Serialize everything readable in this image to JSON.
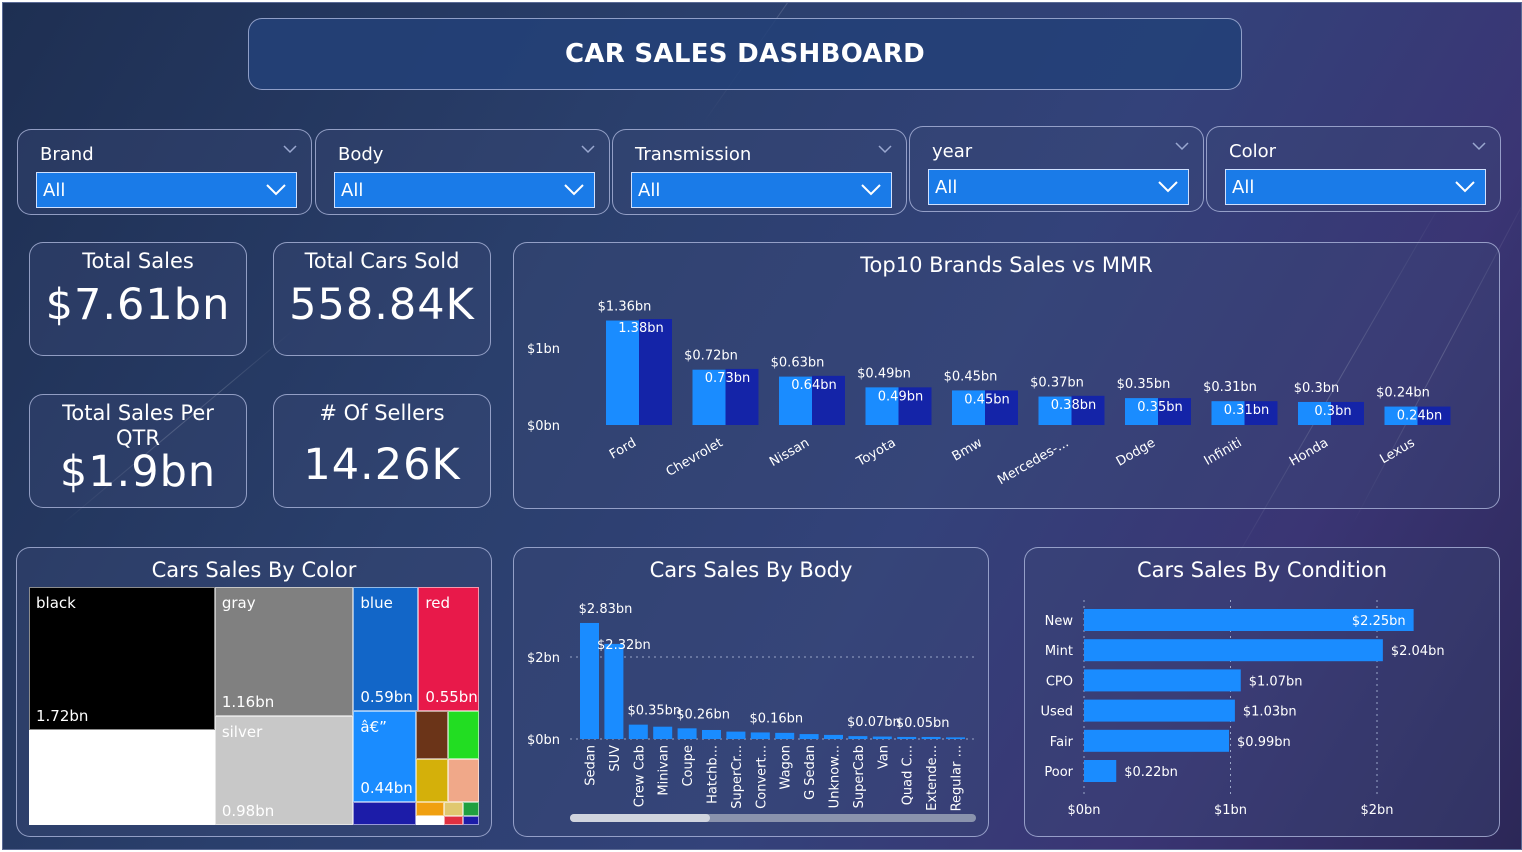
{
  "header": {
    "title": "CAR SALES DASHBOARD"
  },
  "filters": [
    {
      "label": "Brand",
      "value": "All"
    },
    {
      "label": "Body",
      "value": "All"
    },
    {
      "label": "Transmission",
      "value": "All"
    },
    {
      "label": "year",
      "value": "All"
    },
    {
      "label": "Color",
      "value": "All"
    }
  ],
  "kpis": [
    {
      "title": "Total Sales",
      "value": "$7.61bn"
    },
    {
      "title": "Total Cars Sold",
      "value": "558.84K"
    },
    {
      "title": "Total Sales Per QTR",
      "value": "$1.9bn"
    },
    {
      "title": "# Of Sellers",
      "value": "14.26K"
    }
  ],
  "colors": {
    "primary_bar": "#1a8cff",
    "secondary_bar": "#1424a8",
    "panel_border": "#bec8eb"
  },
  "chart_data": [
    {
      "type": "bar",
      "title": "Top10 Brands Sales vs MMR",
      "categories": [
        "Ford",
        "Chevrolet",
        "Nissan",
        "Toyota",
        "Bmw",
        "Mercedes-...",
        "Dodge",
        "Infiniti",
        "Honda",
        "Lexus"
      ],
      "series": [
        {
          "values": [
            1.36,
            0.72,
            0.63,
            0.49,
            0.45,
            0.37,
            0.35,
            0.31,
            0.3,
            0.24
          ],
          "labels": [
            "$1.36bn",
            "$0.72bn",
            "$0.63bn",
            "$0.49bn",
            "$0.45bn",
            "$0.37bn",
            "$0.35bn",
            "$0.31bn",
            "$0.3bn",
            "$0.24bn"
          ]
        },
        {
          "values": [
            1.38,
            0.73,
            0.64,
            0.49,
            0.45,
            0.38,
            0.35,
            0.31,
            0.3,
            0.24
          ],
          "labels": [
            "1.38bn",
            "0.73bn",
            "0.64bn",
            "0.49bn",
            "0.45bn",
            "0.38bn",
            "0.35bn",
            "0.31bn",
            "0.3bn",
            "0.24bn"
          ]
        }
      ],
      "yticks": [
        "$0bn",
        "$1bn"
      ],
      "ylim": [
        0,
        1.4
      ]
    },
    {
      "type": "treemap",
      "title": "Cars Sales By Color",
      "items": [
        {
          "name": "black",
          "value": 1.72,
          "label": "1.72bn",
          "color": "#000000"
        },
        {
          "name": "",
          "value": 1.15,
          "label": "",
          "color": "#ffffff"
        },
        {
          "name": "gray",
          "value": 1.16,
          "label": "1.16bn",
          "color": "#808080"
        },
        {
          "name": "silver",
          "value": 0.98,
          "label": "0.98bn",
          "color": "#c8c8c8"
        },
        {
          "name": "blue",
          "value": 0.59,
          "label": "0.59bn",
          "color": "#1266c8"
        },
        {
          "name": "red",
          "value": 0.55,
          "label": "0.55bn",
          "color": "#e8194a"
        },
        {
          "name": "â€”",
          "value": 0.44,
          "label": "0.44bn",
          "color": "#1a8cff"
        }
      ],
      "small_tiles": [
        "#6b3418",
        "#22dd22",
        "#d4b00a",
        "#f0a889",
        "#f0a010",
        "#e0c870",
        "#1c1ca8",
        "#ffffff",
        "#e03040",
        "#20a040"
      ]
    },
    {
      "type": "bar",
      "title": "Cars Sales By Body",
      "categories": [
        "Sedan",
        "SUV",
        "Crew Cab",
        "Minivan",
        "Coupe",
        "Hatchb...",
        "SuperCr...",
        "Convert...",
        "Wagon",
        "G Sedan",
        "Unknow...",
        "SuperCab",
        "Van",
        "Quad C...",
        "Extende...",
        "Regular ..."
      ],
      "values": [
        2.83,
        2.32,
        0.35,
        0.3,
        0.26,
        0.22,
        0.18,
        0.16,
        0.15,
        0.12,
        0.1,
        0.07,
        0.06,
        0.05,
        0.05,
        0.04
      ],
      "data_labels": {
        "0": "$2.83bn",
        "1": "$2.32bn",
        "2": "$0.35bn",
        "4": "$0.26bn",
        "7": "$0.16bn",
        "11": "$0.07bn",
        "13": "$0.05bn"
      },
      "yticks": [
        "$0bn",
        "$2bn"
      ],
      "ylim": [
        0,
        3
      ]
    },
    {
      "type": "bar",
      "orientation": "horizontal",
      "title": "Cars Sales By Condition",
      "categories": [
        "New",
        "Mint",
        "CPO",
        "Used",
        "Fair",
        "Poor"
      ],
      "values": [
        2.25,
        2.04,
        1.07,
        1.03,
        0.99,
        0.22
      ],
      "labels": [
        "$2.25bn",
        "$2.04bn",
        "$1.07bn",
        "$1.03bn",
        "$0.99bn",
        "$0.22bn"
      ],
      "xticks": [
        "$0bn",
        "$1bn",
        "$2bn"
      ],
      "xlim": [
        0,
        2.05
      ]
    }
  ]
}
